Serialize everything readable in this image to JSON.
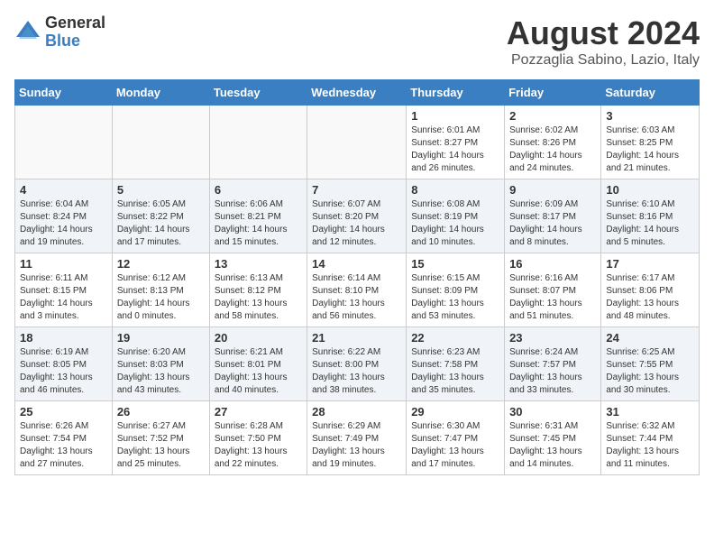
{
  "logo": {
    "general": "General",
    "blue": "Blue"
  },
  "title": "August 2024",
  "subtitle": "Pozzaglia Sabino, Lazio, Italy",
  "days_of_week": [
    "Sunday",
    "Monday",
    "Tuesday",
    "Wednesday",
    "Thursday",
    "Friday",
    "Saturday"
  ],
  "weeks": [
    [
      {
        "day": "",
        "info": ""
      },
      {
        "day": "",
        "info": ""
      },
      {
        "day": "",
        "info": ""
      },
      {
        "day": "",
        "info": ""
      },
      {
        "day": "1",
        "info": "Sunrise: 6:01 AM\nSunset: 8:27 PM\nDaylight: 14 hours\nand 26 minutes."
      },
      {
        "day": "2",
        "info": "Sunrise: 6:02 AM\nSunset: 8:26 PM\nDaylight: 14 hours\nand 24 minutes."
      },
      {
        "day": "3",
        "info": "Sunrise: 6:03 AM\nSunset: 8:25 PM\nDaylight: 14 hours\nand 21 minutes."
      }
    ],
    [
      {
        "day": "4",
        "info": "Sunrise: 6:04 AM\nSunset: 8:24 PM\nDaylight: 14 hours\nand 19 minutes."
      },
      {
        "day": "5",
        "info": "Sunrise: 6:05 AM\nSunset: 8:22 PM\nDaylight: 14 hours\nand 17 minutes."
      },
      {
        "day": "6",
        "info": "Sunrise: 6:06 AM\nSunset: 8:21 PM\nDaylight: 14 hours\nand 15 minutes."
      },
      {
        "day": "7",
        "info": "Sunrise: 6:07 AM\nSunset: 8:20 PM\nDaylight: 14 hours\nand 12 minutes."
      },
      {
        "day": "8",
        "info": "Sunrise: 6:08 AM\nSunset: 8:19 PM\nDaylight: 14 hours\nand 10 minutes."
      },
      {
        "day": "9",
        "info": "Sunrise: 6:09 AM\nSunset: 8:17 PM\nDaylight: 14 hours\nand 8 minutes."
      },
      {
        "day": "10",
        "info": "Sunrise: 6:10 AM\nSunset: 8:16 PM\nDaylight: 14 hours\nand 5 minutes."
      }
    ],
    [
      {
        "day": "11",
        "info": "Sunrise: 6:11 AM\nSunset: 8:15 PM\nDaylight: 14 hours\nand 3 minutes."
      },
      {
        "day": "12",
        "info": "Sunrise: 6:12 AM\nSunset: 8:13 PM\nDaylight: 14 hours\nand 0 minutes."
      },
      {
        "day": "13",
        "info": "Sunrise: 6:13 AM\nSunset: 8:12 PM\nDaylight: 13 hours\nand 58 minutes."
      },
      {
        "day": "14",
        "info": "Sunrise: 6:14 AM\nSunset: 8:10 PM\nDaylight: 13 hours\nand 56 minutes."
      },
      {
        "day": "15",
        "info": "Sunrise: 6:15 AM\nSunset: 8:09 PM\nDaylight: 13 hours\nand 53 minutes."
      },
      {
        "day": "16",
        "info": "Sunrise: 6:16 AM\nSunset: 8:07 PM\nDaylight: 13 hours\nand 51 minutes."
      },
      {
        "day": "17",
        "info": "Sunrise: 6:17 AM\nSunset: 8:06 PM\nDaylight: 13 hours\nand 48 minutes."
      }
    ],
    [
      {
        "day": "18",
        "info": "Sunrise: 6:19 AM\nSunset: 8:05 PM\nDaylight: 13 hours\nand 46 minutes."
      },
      {
        "day": "19",
        "info": "Sunrise: 6:20 AM\nSunset: 8:03 PM\nDaylight: 13 hours\nand 43 minutes."
      },
      {
        "day": "20",
        "info": "Sunrise: 6:21 AM\nSunset: 8:01 PM\nDaylight: 13 hours\nand 40 minutes."
      },
      {
        "day": "21",
        "info": "Sunrise: 6:22 AM\nSunset: 8:00 PM\nDaylight: 13 hours\nand 38 minutes."
      },
      {
        "day": "22",
        "info": "Sunrise: 6:23 AM\nSunset: 7:58 PM\nDaylight: 13 hours\nand 35 minutes."
      },
      {
        "day": "23",
        "info": "Sunrise: 6:24 AM\nSunset: 7:57 PM\nDaylight: 13 hours\nand 33 minutes."
      },
      {
        "day": "24",
        "info": "Sunrise: 6:25 AM\nSunset: 7:55 PM\nDaylight: 13 hours\nand 30 minutes."
      }
    ],
    [
      {
        "day": "25",
        "info": "Sunrise: 6:26 AM\nSunset: 7:54 PM\nDaylight: 13 hours\nand 27 minutes."
      },
      {
        "day": "26",
        "info": "Sunrise: 6:27 AM\nSunset: 7:52 PM\nDaylight: 13 hours\nand 25 minutes."
      },
      {
        "day": "27",
        "info": "Sunrise: 6:28 AM\nSunset: 7:50 PM\nDaylight: 13 hours\nand 22 minutes."
      },
      {
        "day": "28",
        "info": "Sunrise: 6:29 AM\nSunset: 7:49 PM\nDaylight: 13 hours\nand 19 minutes."
      },
      {
        "day": "29",
        "info": "Sunrise: 6:30 AM\nSunset: 7:47 PM\nDaylight: 13 hours\nand 17 minutes."
      },
      {
        "day": "30",
        "info": "Sunrise: 6:31 AM\nSunset: 7:45 PM\nDaylight: 13 hours\nand 14 minutes."
      },
      {
        "day": "31",
        "info": "Sunrise: 6:32 AM\nSunset: 7:44 PM\nDaylight: 13 hours\nand 11 minutes."
      }
    ]
  ]
}
